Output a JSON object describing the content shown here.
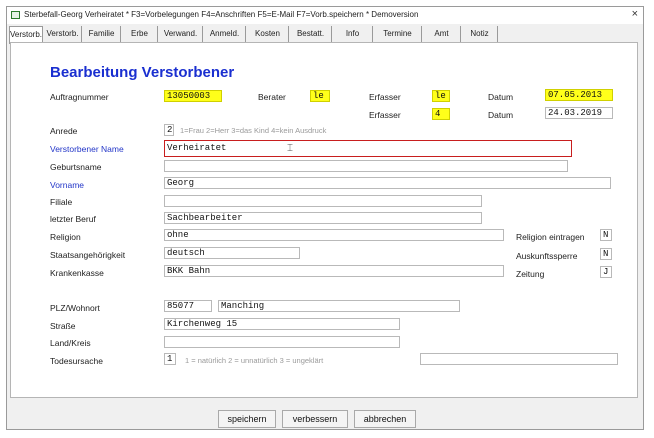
{
  "window": {
    "title": "Sterbefall-Georg Verheiratet  *  F3=Vorbelegungen  F4=Anschriften  F5=E-Mail  F7=Vorb.speichern  *  Demoversion",
    "close_label": "×"
  },
  "tabs": [
    "Verstorb.",
    "Verstorb.",
    "Familie",
    "Erbe",
    "Verwand.",
    "Anmeld.",
    "Kosten",
    "Bestatt.",
    "Info",
    "Termine",
    "Amt",
    "Notiz"
  ],
  "heading": "Bearbeitung Verstorbener",
  "header_fields": {
    "auftrag_label": "Auftragnummer",
    "auftrag_value": "13050003",
    "berater_label": "Berater",
    "berater_value": "le",
    "erfasser_label": "Erfasser",
    "erfasser_value": "le",
    "datum_label": "Datum",
    "datum_value": "07.05.2013",
    "erfasser2_label": "Erfasser",
    "erfasser2_value": "4",
    "datum2_label": "Datum",
    "datum2_value": "24.03.2019"
  },
  "form": {
    "anrede_label": "Anrede",
    "anrede_value": "2",
    "anrede_hint": "1=Frau  2=Herr  3=das Kind  4=kein Ausdruck",
    "name_label": "Verstorbener Name",
    "name_value": "Verheiratet",
    "geburtsname_label": "Geburtsname",
    "geburtsname_value": "",
    "vorname_label": "Vorname",
    "vorname_value": "Georg",
    "filiale_label": "Filiale",
    "filiale_value": "",
    "beruf_label": "letzter Beruf",
    "beruf_value": "Sachbearbeiter",
    "religion_label": "Religion",
    "religion_value": "ohne",
    "religion_eintragen_label": "Religion eintragen",
    "religion_eintragen_value": "N",
    "staat_label": "Staatsangehörigkeit",
    "staat_value": "deutsch",
    "auskunft_label": "Auskunftssperre",
    "auskunft_value": "N",
    "kasse_label": "Krankenkasse",
    "kasse_value": "BKK Bahn",
    "zeitung_label": "Zeitung",
    "zeitung_value": "J",
    "plz_label": "PLZ/Wohnort",
    "plz_value": "85077",
    "ort_value": "Manching",
    "strasse_label": "Straße",
    "strasse_value": "Kirchenweg 15",
    "land_label": "Land/Kreis",
    "land_value": "",
    "tod_label": "Todesursache",
    "tod_value": "1",
    "tod_hint": "1 = natürlich   2 = unnatürlich   3 = ungeklärt",
    "tod_extra_value": ""
  },
  "buttons": {
    "save": "speichern",
    "improve": "verbessern",
    "cancel": "abbrechen"
  },
  "colors": {
    "heading": "#1a2fd0",
    "highlight": "#ffff1a",
    "focus_border": "#c81e1e"
  }
}
